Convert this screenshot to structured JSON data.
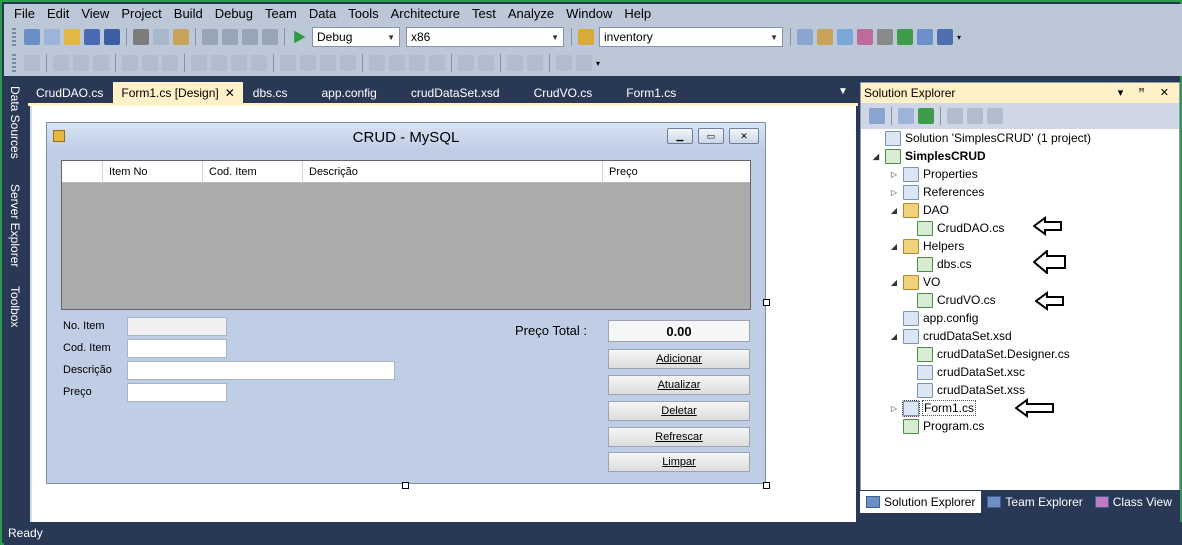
{
  "menu": [
    "File",
    "Edit",
    "View",
    "Project",
    "Build",
    "Debug",
    "Team",
    "Data",
    "Tools",
    "Architecture",
    "Test",
    "Analyze",
    "Window",
    "Help"
  ],
  "toolbar": {
    "config": "Debug",
    "platform": "x86",
    "find": "inventory"
  },
  "left_tabs": {
    "data_sources": "Data Sources",
    "server_explorer": "Server Explorer",
    "toolbox": "Toolbox"
  },
  "doc_tabs": [
    "CrudDAO.cs",
    "Form1.cs [Design]",
    "dbs.cs",
    "app.config",
    "crudDataSet.xsd",
    "CrudVO.cs",
    "Form1.cs"
  ],
  "form": {
    "title": "CRUD - MySQL",
    "grid_columns": [
      "Item No",
      "Cod. Item",
      "Descrição",
      "Preço"
    ],
    "labels": {
      "item_no": "No. Item",
      "cod_item": "Cod. Item",
      "descricao": "Descrição",
      "preco": "Preço"
    },
    "total_label": "Preço Total :",
    "total_value": "0.00",
    "buttons": {
      "adicionar": "Adicionar",
      "atualizar": "Atualizar",
      "deletar": "Deletar",
      "refrescar": "Refrescar",
      "limpar": "Limpar"
    }
  },
  "solution_explorer": {
    "title": "Solution Explorer",
    "title_buttons": "▾ ꟸ ✕",
    "solution": "Solution 'SimplesCRUD' (1 project)",
    "project": "SimplesCRUD",
    "properties": "Properties",
    "references": "References",
    "dao": "DAO",
    "cruddao": "CrudDAO.cs",
    "helpers": "Helpers",
    "dbs": "dbs.cs",
    "vo": "VO",
    "crudvo": "CrudVO.cs",
    "appconfig": "app.config",
    "dataset": "crudDataSet.xsd",
    "dataset_designer": "crudDataSet.Designer.cs",
    "dataset_xsc": "crudDataSet.xsc",
    "dataset_xss": "crudDataSet.xss",
    "form1": "Form1.cs",
    "program": "Program.cs"
  },
  "bottom_tabs": {
    "solution_explorer": "Solution Explorer",
    "team_explorer": "Team Explorer",
    "class_view": "Class View"
  },
  "status": "Ready"
}
